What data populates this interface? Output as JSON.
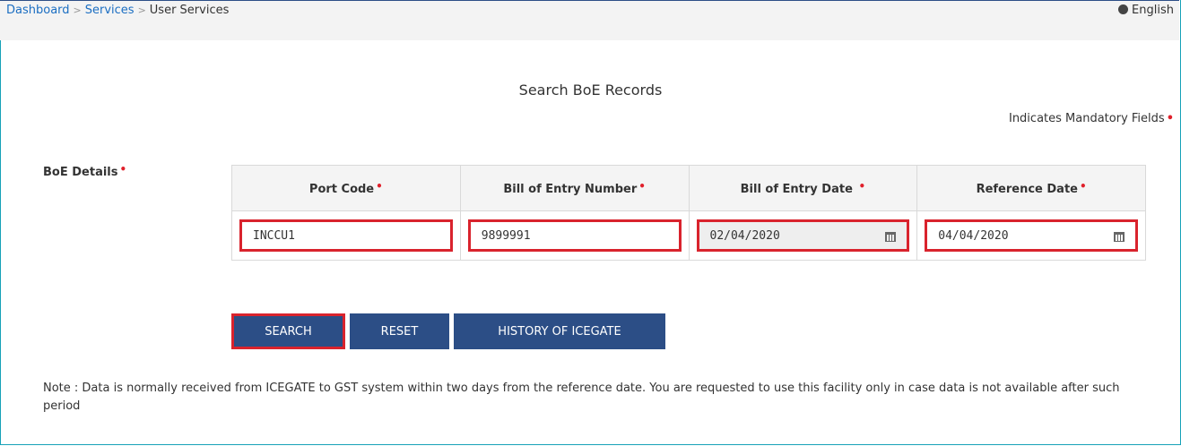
{
  "breadcrumb": {
    "items": [
      "Dashboard",
      "Services"
    ],
    "current": "User Services"
  },
  "language": {
    "icon": "globe-icon",
    "label": "English"
  },
  "page": {
    "title": "Search BoE Records",
    "mandatory_note": "Indicates Mandatory Fields",
    "boe_label": "BoE Details"
  },
  "table": {
    "headers": [
      "Port Code",
      "Bill of Entry Number",
      "Bill of Entry Date",
      "Reference Date"
    ],
    "values": {
      "port_code": "INCCU1",
      "boe_number": "9899991",
      "boe_date": "02/04/2020",
      "reference_date": "04/04/2020"
    }
  },
  "buttons": {
    "search": "SEARCH",
    "reset": "RESET",
    "history": "HISTORY OF ICEGATE"
  },
  "note": "Note : Data is normally received from ICEGATE to GST system within two days from the reference date. You are requested to use this facility only in case data is not available after such period",
  "colors": {
    "primary_button": "#2c4e86",
    "highlight_border": "#d9232d",
    "required_mark": "#e0202b",
    "link": "#1b6ec2"
  }
}
